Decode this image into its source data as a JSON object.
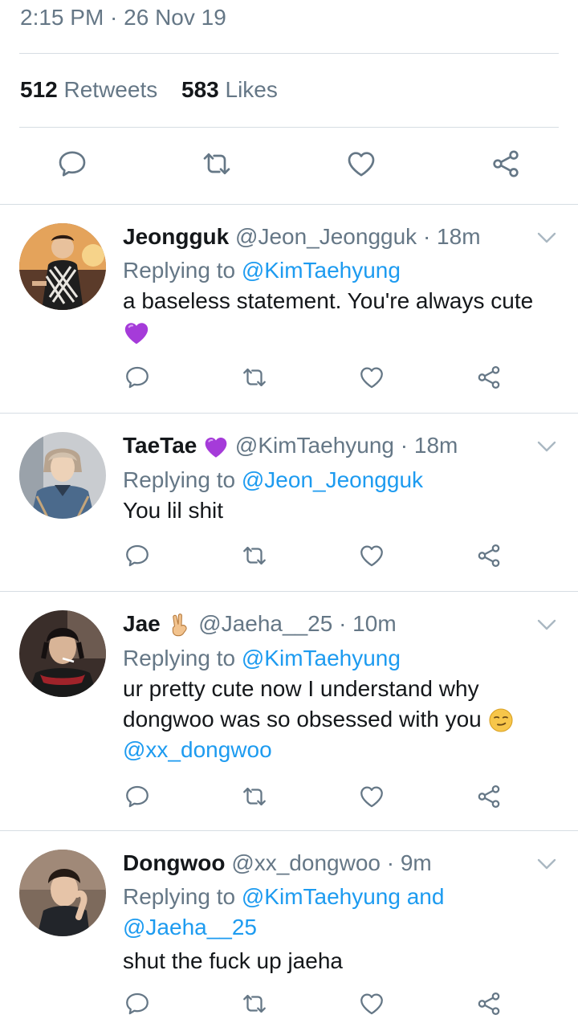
{
  "tweet": {
    "timestamp": "2:15 PM · 26 Nov 19",
    "retweets_count": "512",
    "retweets_label": "Retweets",
    "likes_count": "583",
    "likes_label": "Likes"
  },
  "colors": {
    "link": "#1d9bf0",
    "muted": "#657786",
    "text": "#14171a",
    "purple_heart": "#a53bd9"
  },
  "replies": [
    {
      "name": "Jeongguk",
      "handle": "@Jeon_Jeongguk",
      "time": "· 18m",
      "replying_label": "Replying to",
      "replying_to": "@KimTaehyung",
      "text": "a baseless statement. You're always cute",
      "emoji": "purple-heart"
    },
    {
      "name": "TaeTae",
      "name_emoji": "purple-heart",
      "handle": "@KimTaehyung",
      "time": "· 18m",
      "replying_label": "Replying to",
      "replying_to": "@Jeon_Jeongguk",
      "text": "You lil shit"
    },
    {
      "name": "Jae",
      "name_emoji": "victory-hand",
      "handle": "@Jaeha__25",
      "time": "· 10m",
      "replying_label": "Replying to",
      "replying_to": "@KimTaehyung",
      "text_line1": "ur pretty cute now I understand why",
      "text_line2": "dongwoo was so obsessed with you",
      "text_emoji": "smirking-face",
      "mention": "@xx_dongwoo"
    },
    {
      "name": "Dongwoo",
      "handle": "@xx_dongwoo",
      "time": "· 9m",
      "replying_label": "Replying to",
      "replying_to": "@KimTaehyung and",
      "replying_to_2": "@Jaeha__25",
      "text": "shut the fuck up jaeha"
    }
  ]
}
